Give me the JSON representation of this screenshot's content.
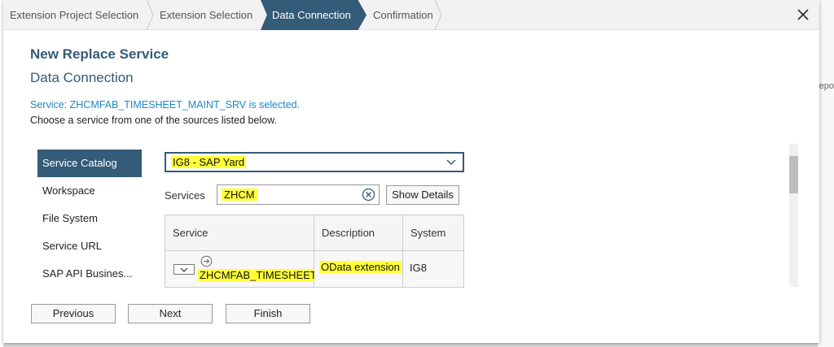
{
  "wizard": {
    "steps": [
      {
        "label": "Extension Project Selection"
      },
      {
        "label": "Extension Selection"
      },
      {
        "label": "Data Connection"
      },
      {
        "label": "Confirmation"
      }
    ],
    "active_step": 2
  },
  "background": {
    "right_text": "epo"
  },
  "header": {
    "title": "New Replace Service",
    "subtitle": "Data Connection"
  },
  "messages": {
    "selected": "Service: ZHCMFAB_TIMESHEET_MAINT_SRV is selected.",
    "instruction": "Choose a service from one of the sources listed below."
  },
  "nav": {
    "items": [
      {
        "label": "Service Catalog"
      },
      {
        "label": "Workspace"
      },
      {
        "label": "File System"
      },
      {
        "label": "Service URL"
      },
      {
        "label": "SAP API Busines..."
      }
    ],
    "active": 0
  },
  "system_select": {
    "value": "IG8 - SAP Yard"
  },
  "services": {
    "label": "Services",
    "search_value": "ZHCM",
    "show_details_label": "Show Details"
  },
  "table": {
    "headers": {
      "service": "Service",
      "description": "Description",
      "system": "System"
    },
    "rows": [
      {
        "service": "ZHCMFAB_TIMESHEET_",
        "description": "OData extension",
        "system": "IG8"
      }
    ]
  },
  "footer": {
    "previous_label": "Previous",
    "next_label": "Next",
    "finish_label": "Finish"
  },
  "colors": {
    "accent": "#345b77",
    "link": "#1d87c7",
    "highlight": "#ffff3a"
  }
}
